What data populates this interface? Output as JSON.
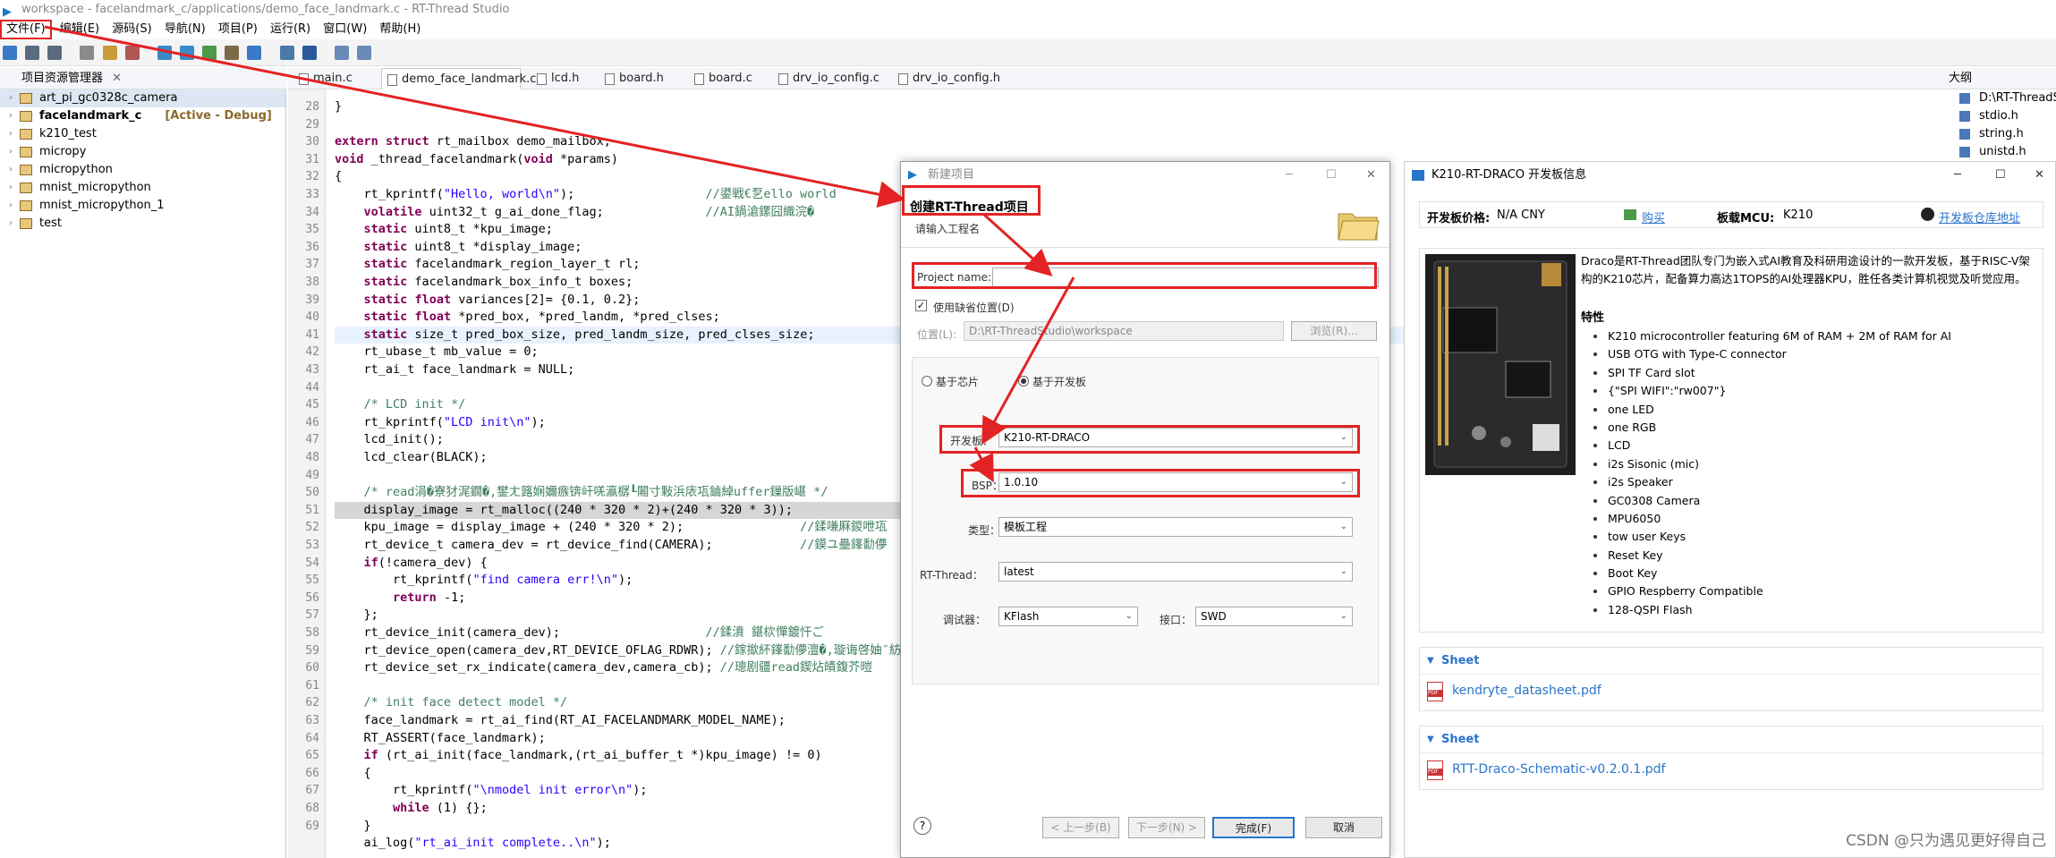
{
  "window": {
    "title": "workspace - facelandmark_c/applications/demo_face_landmark.c - RT-Thread Studio"
  },
  "menu": [
    "文件(F)",
    "编辑(E)",
    "源码(S)",
    "导航(N)",
    "项目(P)",
    "运行(R)",
    "窗口(W)",
    "帮助(H)"
  ],
  "project_explorer": {
    "title": "项目资源管理器",
    "items": [
      {
        "name": "art_pi_gc0328c_camera",
        "bold": false,
        "tag": ""
      },
      {
        "name": "facelandmark_c",
        "bold": true,
        "tag": "[Active - Debug]"
      },
      {
        "name": "k210_test",
        "bold": false,
        "tag": ""
      },
      {
        "name": "micropy",
        "bold": false,
        "tag": ""
      },
      {
        "name": "micropython",
        "bold": false,
        "tag": ""
      },
      {
        "name": "mnist_micropython",
        "bold": false,
        "tag": ""
      },
      {
        "name": "mnist_micropython_1",
        "bold": false,
        "tag": ""
      },
      {
        "name": "test",
        "bold": false,
        "tag": ""
      }
    ]
  },
  "editor_tabs": [
    "main.c",
    "demo_face_landmark.c",
    "lcd.h",
    "board.h",
    "board.c",
    "drv_io_config.c",
    "drv_io_config.h"
  ],
  "editor": {
    "line_numbers": [
      "28",
      "29",
      "30",
      "31",
      "32",
      "33",
      "34",
      "35",
      "36",
      "37",
      "38",
      "39",
      "40",
      "41",
      "42",
      "43",
      "44",
      "45",
      "46",
      "47",
      "48",
      "49",
      "50",
      "51",
      "52",
      "53",
      "54",
      "55",
      "56",
      "57",
      "58",
      "59",
      "60",
      "61",
      "62",
      "63",
      "64",
      "65",
      "66",
      "67",
      "68",
      "69"
    ],
    "lines": [
      "}",
      "",
      "extern struct rt_mailbox demo_mailbox;",
      "void _thread_facelandmark(void *params)",
      "{",
      "    rt_kprintf(\"Hello, world\\n\");                  //鍙戦€乭ello world",
      "    volatile uint32_t g_ai_done_flag;              //AI鍋滄鏍囧織浣�",
      "    static uint8_t *kpu_image;",
      "    static uint8_t *display_image;",
      "    static facelandmark_region_layer_t rl;",
      "    static facelandmark_box_info_t boxes;",
      "    static float variances[2]= {0.1, 0.2};",
      "    static float *pred_box, *pred_landm, *pred_clses;",
      "    static size_t pred_box_size, pred_landm_size, pred_clses_size;",
      "    rt_ubase_t mb_value = 0;",
      "    rt_ai_t face_landmark = NULL;",
      "",
      "    /* LCD init */",
      "    rt_kprintf(\"LCD init\\n\");",
      "    lcd_init();",
      "    lcd_clear(BLACK);",
      "",
      "    /* read涓�寮犲浘鐗�,鐢ㄤ簬娴嬭瘯锛屽唴瀛樼┖闂寸敤浜庡瓨鏀綽uffer鏁版嵁 */",
      "    display_image = rt_malloc((240 * 320 * 2)+(240 * 320 * 3));",
      "    kpu_image = display_image + (240 * 320 * 2);                //鍒嗛厤鍐呭瓨",
      "    rt_device_t camera_dev = rt_device_find(CAMERA);            //鏌ユ壘鎽勫儚",
      "    if(!camera_dev) {",
      "        rt_kprintf(\"find camera err!\\n\");",
      "        return -1;",
      "    };",
      "    rt_device_init(camera_dev);                    //鍒濆 鍖栨憚鍍忓ご",
      "    rt_device_open(camera_dev,RT_DEVICE_OFLAG_RDWR); //鎵撳紑鎽勫儚澶�,璇诲啓妯″紡",
      "    rt_device_set_rx_indicate(camera_dev,camera_cb); //璁剧疆read鍥炶皟鍑芥暟",
      "",
      "    /* init face detect model */",
      "    face_landmark = rt_ai_find(RT_AI_FACELANDMARK_MODEL_NAME);",
      "    RT_ASSERT(face_landmark);",
      "    if (rt_ai_init(face_landmark,(rt_ai_buffer_t *)kpu_image) != 0)",
      "    {",
      "        rt_kprintf(\"\\nmodel init error\\n\");",
      "        while (1) {};",
      "    }",
      "    ai_log(\"rt_ai_init complete..\\n\");"
    ]
  },
  "outline": {
    "title": "大纲",
    "items": [
      "D:\\RT-ThreadS",
      "stdio.h",
      "string.h",
      "unistd.h"
    ]
  },
  "new_project_dialog": {
    "window_title": "新建项目",
    "heading": "创建RT-Thread项目",
    "subheading": "请输入工程名",
    "project_name_label": "Project name:",
    "project_name_value": "",
    "use_default_label": "使用缺省位置(D)",
    "use_default_checked": true,
    "location_label": "位置(L):",
    "location_value": "D:\\RT-ThreadStudio\\workspace",
    "browse_label": "浏览(R)...",
    "radio_chip": "基于芯片",
    "radio_board": "基于开发板",
    "selected_radio": "board",
    "board_label": "开发板：",
    "board_value": "K210-RT-DRACO",
    "bsp_label": "BSP：",
    "bsp_value": "1.0.10",
    "type_label": "类型：",
    "type_value": "模板工程",
    "rtthread_label": "RT-Thread：",
    "rtthread_value": "latest",
    "debugger_label": "调试器：",
    "debugger_value": "KFlash",
    "interface_label": "接口：",
    "interface_value": "SWD",
    "btn_back": "< 上一步(B)",
    "btn_next": "下一步(N) >",
    "btn_finish": "完成(F)",
    "btn_cancel": "取消",
    "help": "?"
  },
  "board_panel": {
    "title": "K210-RT-DRACO 开发板信息",
    "price_label": "开发板价格:",
    "price_value": "N/A CNY",
    "buy_label": "购买",
    "mcu_label": "板载MCU:",
    "mcu_value": "K210",
    "repo_label": "开发板仓库地址",
    "description": "Draco是RT-Thread团队专门为嵌入式AI教育及科研用途设计的一款开发板，基于RISC-V架构的K210芯片，配备算力高达1TOPS的AI处理器KPU，胜任各类计算机视觉及听觉应用。",
    "features_title": "特性",
    "features": [
      "K210 microcontroller featuring 6M of RAM + 2M of RAM for AI",
      "USB OTG with Type-C connector",
      "SPI TF Card slot",
      "{\"SPI WIFI\":\"rw007\"}",
      "one LED",
      "one RGB",
      "LCD",
      "i2s Sisonic (mic)",
      "i2s Speaker",
      "GC0308 Camera",
      "MPU6050",
      "tow user Keys",
      "Reset Key",
      "Boot Key",
      "GPIO Respberry Compatible",
      "128-QSPI Flash"
    ],
    "sheets": [
      {
        "label": "Sheet",
        "file": "kendryte_datasheet.pdf"
      },
      {
        "label": "Sheet",
        "file": "RTT-Draco-Schematic-v0.2.0.1.pdf"
      }
    ]
  },
  "watermark": "CSDN @只为遇见更好得自己",
  "colors": {
    "annotation_red": "#e32323",
    "link_blue": "#2a74c9",
    "keyword": "#7f0055",
    "comment": "#3f7f5f"
  }
}
